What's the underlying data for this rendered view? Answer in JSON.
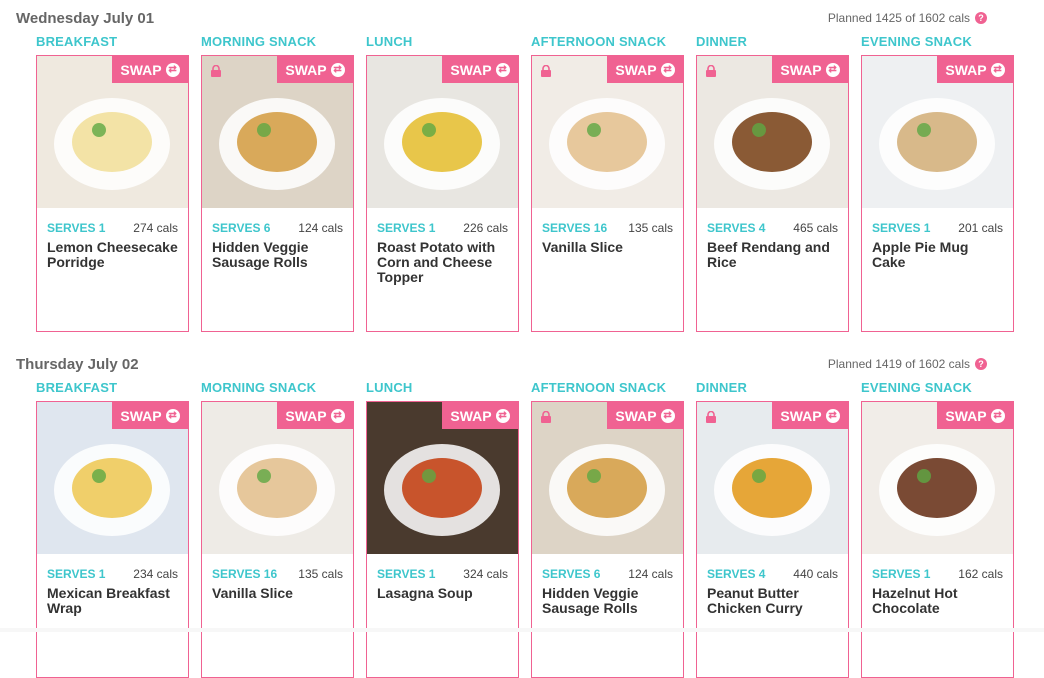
{
  "days": [
    {
      "title": "Wednesday July 01",
      "planned": "Planned 1425 of 1602 cals",
      "meals": [
        {
          "slot": "BREAKFAST",
          "serves": "SERVES 1",
          "cals": "274 cals",
          "name": "Lemon Cheesecake Porridge",
          "locked": false,
          "bg": "#efe9df",
          "food": "#f3e3a6"
        },
        {
          "slot": "MORNING SNACK",
          "serves": "SERVES 6",
          "cals": "124 cals",
          "name": "Hidden Veggie Sausage Rolls",
          "locked": true,
          "bg": "#ddd4c6",
          "food": "#d9a95a"
        },
        {
          "slot": "LUNCH",
          "serves": "SERVES 1",
          "cals": "226 cals",
          "name": "Roast Potato with Corn and Cheese Topper",
          "locked": false,
          "bg": "#e8e6e1",
          "food": "#e8c64a"
        },
        {
          "slot": "AFTERNOON SNACK",
          "serves": "SERVES 16",
          "cals": "135 cals",
          "name": "Vanilla Slice",
          "locked": true,
          "bg": "#f1ece6",
          "food": "#e7c89c"
        },
        {
          "slot": "DINNER",
          "serves": "SERVES 4",
          "cals": "465 cals",
          "name": "Beef Rendang and Rice",
          "locked": true,
          "bg": "#ece8e2",
          "food": "#8a5a35"
        },
        {
          "slot": "EVENING SNACK",
          "serves": "SERVES 1",
          "cals": "201 cals",
          "name": "Apple Pie Mug Cake",
          "locked": false,
          "bg": "#eef0f2",
          "food": "#d8b98a"
        }
      ]
    },
    {
      "title": "Thursday July 02",
      "planned": "Planned 1419 of 1602 cals",
      "meals": [
        {
          "slot": "BREAKFAST",
          "serves": "SERVES 1",
          "cals": "234 cals",
          "name": "Mexican Breakfast Wrap",
          "locked": false,
          "bg": "#dfe6ef",
          "food": "#f0cf6a"
        },
        {
          "slot": "MORNING SNACK",
          "serves": "SERVES 16",
          "cals": "135 cals",
          "name": "Vanilla Slice",
          "locked": false,
          "bg": "#eeebe6",
          "food": "#e6c79b"
        },
        {
          "slot": "LUNCH",
          "serves": "SERVES 1",
          "cals": "324 cals",
          "name": "Lasagna Soup",
          "locked": false,
          "bg": "#4a3a2e",
          "food": "#c8542c"
        },
        {
          "slot": "AFTERNOON SNACK",
          "serves": "SERVES 6",
          "cals": "124 cals",
          "name": "Hidden Veggie Sausage Rolls",
          "locked": true,
          "bg": "#ddd4c6",
          "food": "#d9a95a"
        },
        {
          "slot": "DINNER",
          "serves": "SERVES 4",
          "cals": "440 cals",
          "name": "Peanut Butter Chicken Curry",
          "locked": true,
          "bg": "#e7ebee",
          "food": "#e6a638"
        },
        {
          "slot": "EVENING SNACK",
          "serves": "SERVES 1",
          "cals": "162 cals",
          "name": "Hazelnut Hot Chocolate",
          "locked": false,
          "bg": "#f1ede8",
          "food": "#7a4a34"
        }
      ]
    }
  ],
  "swap_label": "SWAP",
  "help_glyph": "?",
  "accent": "#f06292",
  "teal": "#3ec6cc"
}
